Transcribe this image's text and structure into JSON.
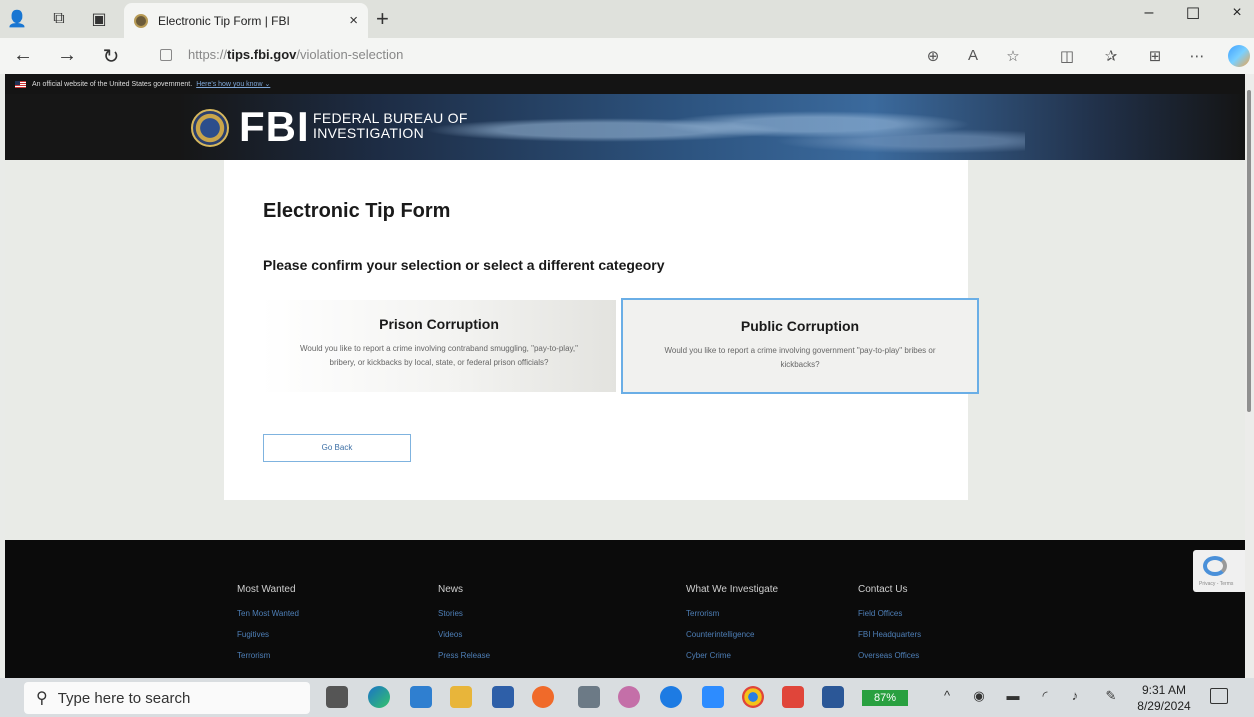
{
  "browser": {
    "tab_title": "Electronic Tip Form | FBI",
    "tab_close": "×",
    "new_tab": "+",
    "url_scheme": "https://",
    "url_domain": "tips.fbi.gov",
    "url_path": "/violation-selection",
    "window_controls": {
      "minimize": "–",
      "maximize": "☐",
      "close": "×"
    }
  },
  "gov_banner": {
    "text": "An official website of the United States government.",
    "link": "Here's how you know ⌄"
  },
  "header": {
    "logo_text": "FBI",
    "logo_sub_line1": "FEDERAL BUREAU OF",
    "logo_sub_line2": "INVESTIGATION"
  },
  "main": {
    "title": "Electronic Tip Form",
    "subtitle": "Please confirm your selection or select a different categeory",
    "cards": [
      {
        "title": "Prison Corruption",
        "description": "Would you like to report a crime involving contraband smuggling, \"pay-to-play,\" bribery, or kickbacks by local, state, or federal prison officials?"
      },
      {
        "title": "Public Corruption",
        "description": "Would you like to report a crime involving government \"pay-to-play\" bribes or kickbacks?",
        "selected": true
      }
    ],
    "go_back": "Go Back"
  },
  "footer": {
    "columns": [
      {
        "heading": "Most Wanted",
        "links": [
          "Ten Most Wanted",
          "Fugitives",
          "Terrorism"
        ]
      },
      {
        "heading": "News",
        "links": [
          "Stories",
          "Videos",
          "Press Release"
        ]
      },
      {
        "heading": "What We Investigate",
        "links": [
          "Terrorism",
          "Counterintelligence",
          "Cyber Crime"
        ]
      },
      {
        "heading": "Contact Us",
        "links": [
          "Field Offices",
          "FBI Headquarters",
          "Overseas Offices"
        ]
      }
    ]
  },
  "recaptcha": {
    "text": "Privacy - Terms"
  },
  "taskbar": {
    "search_placeholder": "Type here to search",
    "battery": "87%",
    "time": "9:31 AM",
    "date": "8/29/2024"
  },
  "colors": {
    "accent_border": "#6aaee6",
    "link": "#4e7fb7",
    "footer_bg": "#0b0b0b"
  }
}
